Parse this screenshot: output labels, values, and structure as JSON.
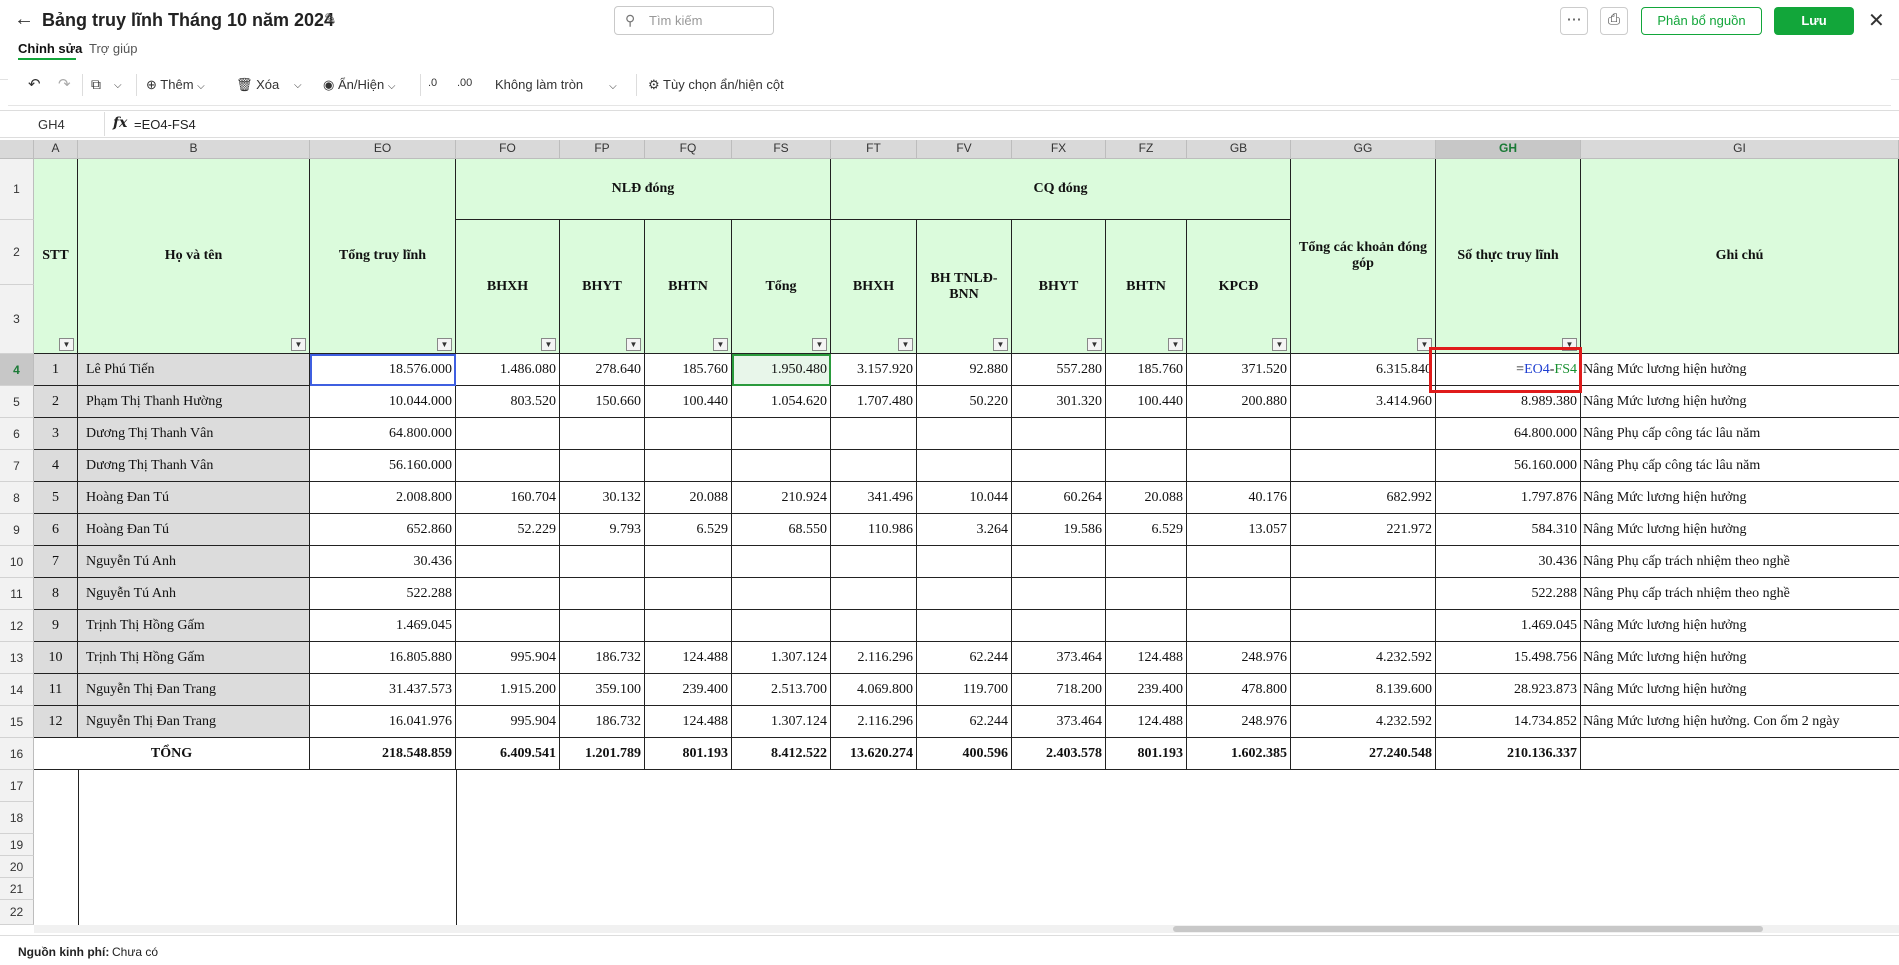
{
  "header": {
    "title": "Bảng truy lĩnh Tháng 10 năm 2024",
    "search_placeholder": "Tìm kiếm",
    "allocate_label": "Phân bổ nguồn",
    "save_label": "Lưu",
    "tabs": [
      "Chỉnh sửa",
      "Trợ giúp"
    ]
  },
  "toolbar": {
    "add_label": "Thêm",
    "delete_label": "Xóa",
    "show_hide_label": "Ẩn/Hiện",
    "decrease_decimal": ".0",
    "increase_decimal": ".00",
    "rounding_label": "Không làm tròn",
    "column_options_label": "Tùy chọn ẩn/hiện cột"
  },
  "formula_bar": {
    "cell_ref": "GH4",
    "fx": "fx",
    "formula": "=EO4-FS4"
  },
  "grid": {
    "col_letters": [
      "A",
      "B",
      "EO",
      "FO",
      "FP",
      "FQ",
      "FS",
      "FT",
      "FV",
      "FX",
      "FZ",
      "GB",
      "GG",
      "GH",
      "GI"
    ],
    "selected_col": "GH",
    "selected_row": "4",
    "headers": {
      "stt": "STT",
      "name": "Họ và tên",
      "total": "Tổng truy lĩnh",
      "employee_group": "NLĐ đóng",
      "employer_group": "CQ đóng",
      "bhxh": "BHXH",
      "bhyt": "BHYT",
      "bhtn": "BHTN",
      "sum": "Tổng",
      "bhtnld": "BH TNLĐ-BNN",
      "kpcd": "KPCĐ",
      "contrib": "Tổng các khoản đóng góp",
      "net": "Số thực truy lĩnh",
      "note": "Ghi chú"
    },
    "editing_formula_parts": [
      "=",
      "EO4",
      "-",
      "FS4"
    ],
    "rows": [
      [
        "1",
        "Lê Phú Tiến",
        "18.576.000",
        "1.486.080",
        "278.640",
        "185.760",
        "1.950.480",
        "3.157.920",
        "92.880",
        "557.280",
        "185.760",
        "371.520",
        "6.315.840",
        "",
        "Nâng Mức lương hiện hưởng"
      ],
      [
        "2",
        "Phạm Thị Thanh  Hường",
        "10.044.000",
        "803.520",
        "150.660",
        "100.440",
        "1.054.620",
        "1.707.480",
        "50.220",
        "301.320",
        "100.440",
        "200.880",
        "3.414.960",
        "8.989.380",
        "Nâng Mức lương hiện hưởng"
      ],
      [
        "3",
        "Dương Thị Thanh Vân",
        "64.800.000",
        "",
        "",
        "",
        "",
        "",
        "",
        "",
        "",
        "",
        "",
        "64.800.000",
        "Nâng Phụ cấp công tác lâu năm"
      ],
      [
        "4",
        "Dương Thị Thanh Vân",
        "56.160.000",
        "",
        "",
        "",
        "",
        "",
        "",
        "",
        "",
        "",
        "",
        "56.160.000",
        "Nâng Phụ cấp công tác lâu năm"
      ],
      [
        "5",
        "Hoàng Đan Tú",
        "2.008.800",
        "160.704",
        "30.132",
        "20.088",
        "210.924",
        "341.496",
        "10.044",
        "60.264",
        "20.088",
        "40.176",
        "682.992",
        "1.797.876",
        "Nâng Mức lương hiện hưởng"
      ],
      [
        "6",
        "Hoàng Đan Tú",
        "652.860",
        "52.229",
        "9.793",
        "6.529",
        "68.550",
        "110.986",
        "3.264",
        "19.586",
        "6.529",
        "13.057",
        "221.972",
        "584.310",
        "Nâng Mức lương hiện hưởng"
      ],
      [
        "7",
        "Nguyễn Tú Anh",
        "30.436",
        "",
        "",
        "",
        "",
        "",
        "",
        "",
        "",
        "",
        "",
        "30.436",
        "Nâng Phụ cấp trách nhiệm theo nghề"
      ],
      [
        "8",
        "Nguyễn Tú Anh",
        "522.288",
        "",
        "",
        "",
        "",
        "",
        "",
        "",
        "",
        "",
        "",
        "522.288",
        "Nâng Phụ cấp trách nhiệm theo nghề"
      ],
      [
        "9",
        "Trịnh Thị Hồng Gấm",
        "1.469.045",
        "",
        "",
        "",
        "",
        "",
        "",
        "",
        "",
        "",
        "",
        "1.469.045",
        "Nâng Mức lương hiện hưởng"
      ],
      [
        "10",
        "Trịnh Thị Hồng Gấm",
        "16.805.880",
        "995.904",
        "186.732",
        "124.488",
        "1.307.124",
        "2.116.296",
        "62.244",
        "373.464",
        "124.488",
        "248.976",
        "4.232.592",
        "15.498.756",
        "Nâng Mức lương hiện hưởng"
      ],
      [
        "11",
        "Nguyễn Thị  Đan Trang",
        "31.437.573",
        "1.915.200",
        "359.100",
        "239.400",
        "2.513.700",
        "4.069.800",
        "119.700",
        "718.200",
        "239.400",
        "478.800",
        "8.139.600",
        "28.923.873",
        "Nâng Mức lương hiện hưởng"
      ],
      [
        "12",
        "Nguyễn Thị  Đan Trang",
        "16.041.976",
        "995.904",
        "186.732",
        "124.488",
        "1.307.124",
        "2.116.296",
        "62.244",
        "373.464",
        "124.488",
        "248.976",
        "4.232.592",
        "14.734.852",
        "Nâng Mức lương hiện hưởng. Con ốm 2 ngày"
      ]
    ],
    "total_label": "TỔNG",
    "totals": [
      "218.548.859",
      "6.409.541",
      "1.201.789",
      "801.193",
      "8.412.522",
      "13.620.274",
      "400.596",
      "2.403.578",
      "801.193",
      "1.602.385",
      "27.240.548",
      "210.136.337",
      ""
    ],
    "row_numbers": [
      "1",
      "2",
      "3",
      "4",
      "5",
      "6",
      "7",
      "8",
      "9",
      "10",
      "11",
      "12",
      "13",
      "14",
      "15",
      "16",
      "17",
      "18",
      "19",
      "20",
      "21",
      "22"
    ]
  },
  "footer": {
    "label": "Nguồn kinh phí:",
    "value": "Chưa có"
  },
  "colors": {
    "accent": "#12a63a",
    "header_fill": "#dbfbdc",
    "highlight_box": "#e01b1b",
    "formula_ref1": "#1f3fd1",
    "formula_ref2": "#17902f"
  }
}
